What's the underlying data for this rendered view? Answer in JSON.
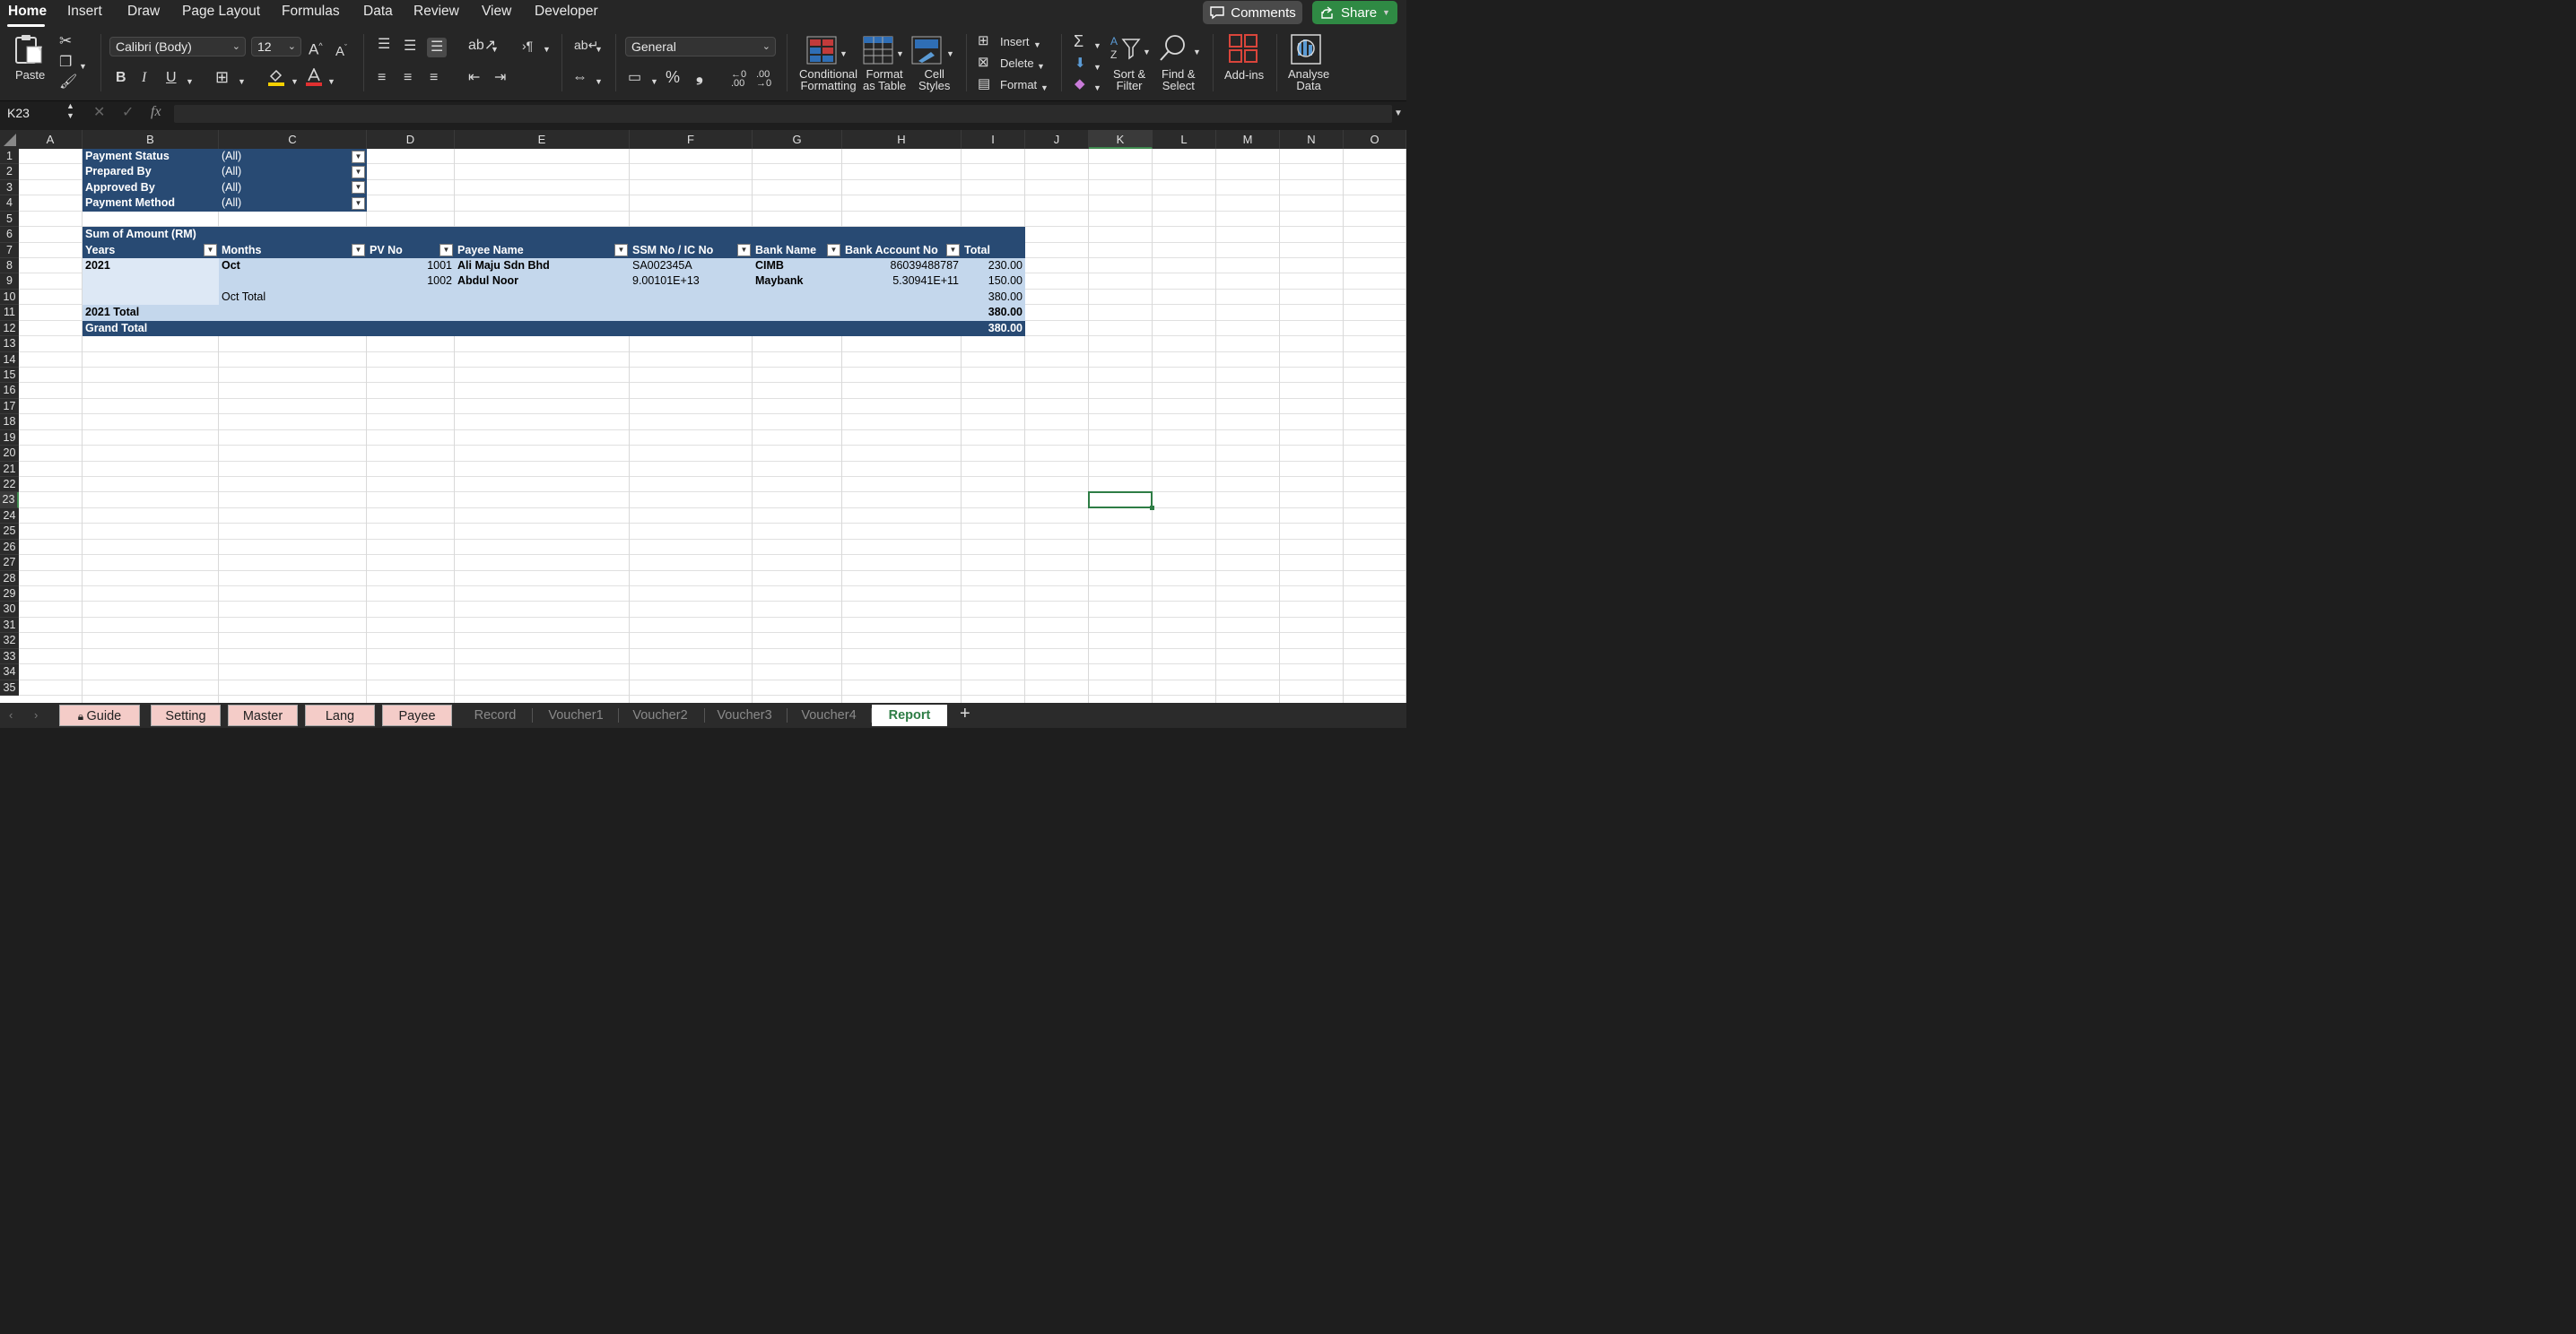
{
  "menu": {
    "tabs": [
      "Home",
      "Insert",
      "Draw",
      "Page Layout",
      "Formulas",
      "Data",
      "Review",
      "View",
      "Developer"
    ],
    "comments": "Comments",
    "share": "Share"
  },
  "ribbon": {
    "paste": "Paste",
    "font_name": "Calibri (Body)",
    "font_size": "12",
    "bold": "B",
    "italic": "I",
    "underline": "U",
    "number_format": "General",
    "percent": "%",
    "comma": "❟",
    "conditional_formatting": [
      "Conditional",
      "Formatting"
    ],
    "format_as_table": [
      "Format",
      "as Table"
    ],
    "cell_styles": [
      "Cell",
      "Styles"
    ],
    "insert": "Insert",
    "delete": "Delete",
    "format": "Format",
    "sort_filter": [
      "Sort &",
      "Filter"
    ],
    "find_select": [
      "Find &",
      "Select"
    ],
    "add_ins": "Add-ins",
    "analyse_data": [
      "Analyse",
      "Data"
    ],
    "icons": {
      "fill_color": "#f5d000",
      "font_color": "#e03030"
    }
  },
  "formula_bar": {
    "name_box": "K23",
    "fx": "fx",
    "value": ""
  },
  "columns": [
    "A",
    "B",
    "C",
    "D",
    "E",
    "F",
    "G",
    "H",
    "I",
    "J",
    "K",
    "L",
    "M",
    "N",
    "O"
  ],
  "rows": [
    "1",
    "2",
    "3",
    "4",
    "5",
    "6",
    "7",
    "8",
    "9",
    "10",
    "11",
    "12",
    "13",
    "14",
    "15",
    "16",
    "17",
    "18",
    "19",
    "20",
    "21",
    "22",
    "23",
    "24",
    "25",
    "26",
    "27",
    "28",
    "29",
    "30",
    "31",
    "32",
    "33",
    "34",
    "35"
  ],
  "selected": {
    "column": "K",
    "row": "23"
  },
  "pivot": {
    "filters": [
      {
        "label": "Payment Status",
        "value": "(All)"
      },
      {
        "label": "Prepared By",
        "value": "(All)"
      },
      {
        "label": "Approved By",
        "value": "(All)"
      },
      {
        "label": "Payment Method",
        "value": "(All)"
      }
    ],
    "title": "Sum of Amount (RM)",
    "headers": [
      "Years",
      "Months",
      "PV No",
      "Payee Name",
      "SSM No / IC No",
      "Bank Name",
      "Bank Account No",
      "Total"
    ],
    "rows": [
      {
        "year": "2021",
        "month": "Oct",
        "pv": "1001",
        "payee": "Ali Maju Sdn Bhd",
        "ssm": "SA002345A",
        "bank": "CIMB",
        "account": "86039488787",
        "total": "230.00"
      },
      {
        "year": "",
        "month": "",
        "pv": "1002",
        "payee": "Abdul Noor",
        "ssm": "9.00101E+13",
        "bank": "Maybank",
        "account": "5.30941E+11",
        "total": "150.00"
      }
    ],
    "month_total": {
      "label": "Oct Total",
      "value": "380.00"
    },
    "year_total": {
      "label": "2021 Total",
      "value": "380.00"
    },
    "grand_total": {
      "label": "Grand Total",
      "value": "380.00"
    }
  },
  "sheet_tabs": [
    {
      "name": "Guide",
      "locked": true
    },
    {
      "name": "Setting"
    },
    {
      "name": "Master"
    },
    {
      "name": "Lang"
    },
    {
      "name": "Payee"
    },
    {
      "name": "Record"
    },
    {
      "name": "Voucher1"
    },
    {
      "name": "Voucher2"
    },
    {
      "name": "Voucher3"
    },
    {
      "name": "Voucher4"
    },
    {
      "name": "Report",
      "active": true
    }
  ]
}
